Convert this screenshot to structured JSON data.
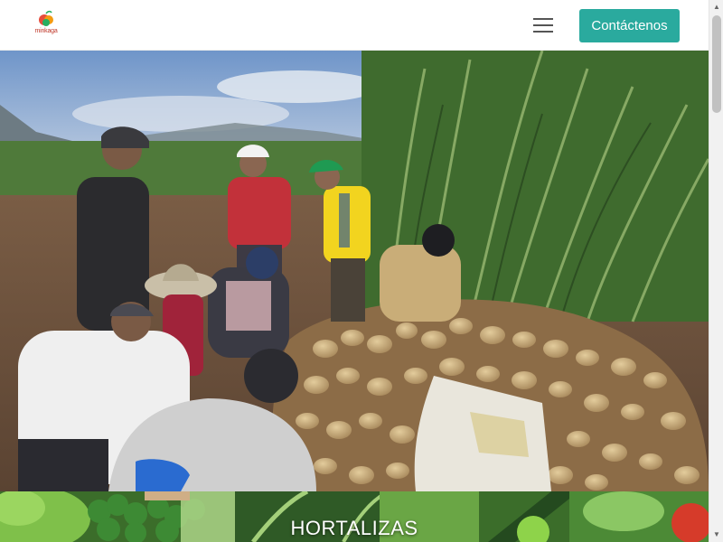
{
  "header": {
    "logo_text": "minkaga",
    "contact_button_label": "Contáctenos",
    "menu_icon": "hamburger-menu-icon"
  },
  "hero": {
    "image_subject": "farm-workers-harvesting-potatoes"
  },
  "category": {
    "title": "HORTALIZAS"
  },
  "colors": {
    "accent": "#2aaa9e",
    "logo_red": "#c0392b"
  },
  "scrollbar": {
    "up_icon": "scroll-up-arrow-icon",
    "down_icon": "scroll-down-arrow-icon"
  }
}
